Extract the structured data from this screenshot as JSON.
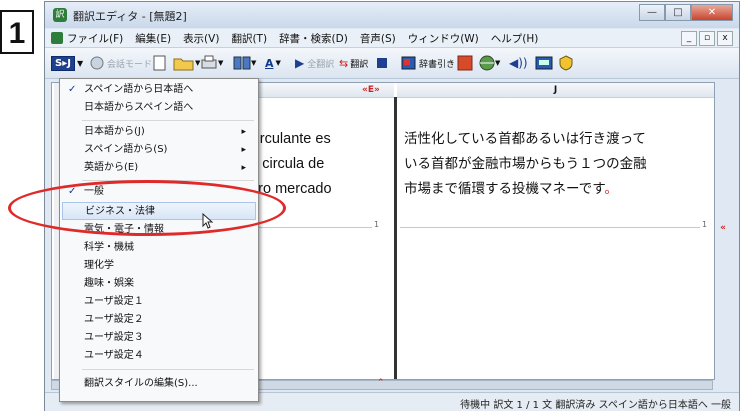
{
  "step_number": "1",
  "window": {
    "title": "翻訳エディタ - [無題2]",
    "controls": [
      "—",
      "□",
      "✕"
    ]
  },
  "menubar": {
    "items": [
      "ファイル(F)",
      "編集(E)",
      "表示(V)",
      "翻訳(T)",
      "辞書・検索(D)",
      "音声(S)",
      "ウィンドウ(W)",
      "ヘルプ(H)"
    ],
    "mdi_controls": [
      "_",
      "▫",
      "x"
    ]
  },
  "toolbar": {
    "direction_button": "S▸J",
    "mode_label": "会話モード",
    "translate_all_label": "全翻訳",
    "translate_label": "翻訳",
    "dict_label": "辞書引き"
  },
  "editor": {
    "col_e_header": "«E»",
    "col_j_header": "J",
    "source_text": "al circulante es\nque circula de\na otro mercado",
    "target_text_main": "活性化している首都あるいは行き渡って\nいる首都が金融市場からもう１つの金融\n市場まで循環する投機マネーです",
    "target_text_end": "。",
    "line_number": "1"
  },
  "dropdown_menu": {
    "items": [
      {
        "label": "スペイン語から日本語へ",
        "checked": true
      },
      {
        "label": "日本語からスペイン語へ"
      },
      {
        "label": "日本語から(J)",
        "submenu": true
      },
      {
        "label": "スペイン語から(S)",
        "submenu": true
      },
      {
        "label": "英語から(E)",
        "submenu": true
      },
      {
        "label": "一般",
        "checked": true
      },
      {
        "label": "ビジネス・法律",
        "highlighted": true
      },
      {
        "label": "電気・電子・情報"
      },
      {
        "label": "科学・機械"
      },
      {
        "label": "理化学"
      },
      {
        "label": "趣味・娯楽"
      },
      {
        "label": "ユーザ設定１"
      },
      {
        "label": "ユーザ設定２"
      },
      {
        "label": "ユーザ設定３"
      },
      {
        "label": "ユーザ設定４"
      },
      {
        "label": "翻訳スタイルの編集(S)..."
      }
    ]
  },
  "statusbar": {
    "text": "待機中  訳文  1 / 1 文  翻訳済み  スペイン語から日本語へ  一般"
  },
  "colors": {
    "highlight_ellipse": "#e02a2a",
    "checkmark": "#1d3a8a"
  }
}
